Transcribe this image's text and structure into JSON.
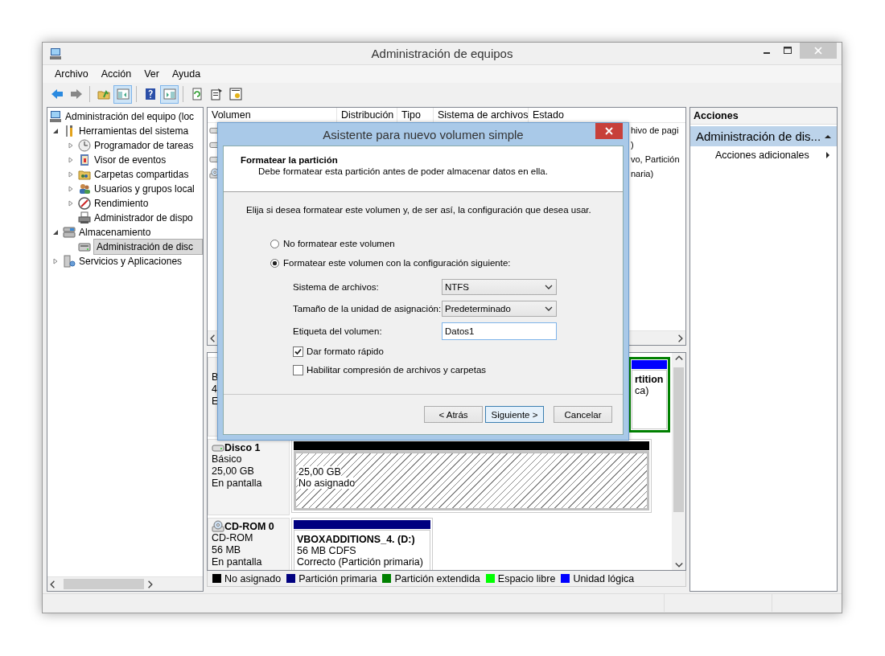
{
  "window": {
    "title": "Administración de equipos"
  },
  "menu": [
    "Archivo",
    "Acción",
    "Ver",
    "Ayuda"
  ],
  "toolbar": [
    [
      {
        "kind": "back",
        "on": false
      },
      {
        "kind": "forward",
        "on": false
      }
    ],
    [
      {
        "kind": "up",
        "on": false
      },
      {
        "kind": "tree-toggle",
        "on": true
      }
    ],
    [
      {
        "kind": "help",
        "on": false
      },
      {
        "kind": "actions-toggle",
        "on": true
      }
    ],
    [
      {
        "kind": "refresh",
        "on": false
      },
      {
        "kind": "properties",
        "on": false
      },
      {
        "kind": "export",
        "on": false
      }
    ]
  ],
  "tree": {
    "label": "Administración del equipo (loc",
    "kind": "computer",
    "selected": false,
    "children": [
      {
        "label": "Herramientas del sistema",
        "kind": "tools",
        "expanded": true,
        "selected": false,
        "children": [
          {
            "label": "Programador de tareas",
            "kind": "clock",
            "expanded": false,
            "selected": false
          },
          {
            "label": "Visor de eventos",
            "kind": "events",
            "expanded": false,
            "selected": false
          },
          {
            "label": "Carpetas compartidas",
            "kind": "shared",
            "expanded": false,
            "selected": false
          },
          {
            "label": "Usuarios y grupos local",
            "kind": "users",
            "expanded": false,
            "selected": false
          },
          {
            "label": "Rendimiento",
            "kind": "performance",
            "expanded": false,
            "selected": false
          },
          {
            "label": "Administrador de dispo",
            "kind": "devices",
            "selected": false
          }
        ]
      },
      {
        "label": "Almacenamiento",
        "kind": "storage",
        "expanded": true,
        "selected": false,
        "children": [
          {
            "label": "Administración de disc",
            "kind": "diskmgmt",
            "selected": true
          }
        ]
      },
      {
        "label": "Servicios y Aplicaciones",
        "kind": "services",
        "expanded": false,
        "selected": false
      }
    ]
  },
  "volume_list": {
    "columns": [
      "Volumen",
      "Distribución",
      "Tipo",
      "Sistema de archivos",
      "Estado"
    ],
    "rows": [
      {
        "kind": "disk",
        "estado": "hivo de pagi"
      },
      {
        "kind": "disk",
        "estado": ")"
      },
      {
        "kind": "disk",
        "estado": "vo, Partición"
      },
      {
        "kind": "cd",
        "estado": "naria)"
      }
    ]
  },
  "disks": [
    {
      "lines": [
        "B",
        "4",
        "E"
      ],
      "partitions": [
        {
          "kind": "logical",
          "name": "rtition",
          "status": "ca)"
        }
      ]
    },
    {
      "kind": "disk",
      "name": "Disco 1",
      "lines": [
        "Básico",
        "25,00 GB",
        "En pantalla"
      ],
      "partitions": [
        {
          "kind": "unallocated",
          "size": "25,00 GB",
          "status": "No asignado"
        }
      ]
    },
    {
      "kind": "cd",
      "name": "CD-ROM 0",
      "lines": [
        "CD-ROM",
        "56 MB",
        "En pantalla"
      ],
      "partitions": [
        {
          "kind": "primary",
          "name": "VBOXADDITIONS_4.  (D:)",
          "size": "56 MB CDFS",
          "status": "Correcto (Partición primaria)"
        }
      ]
    }
  ],
  "legend": [
    {
      "label": "No asignado",
      "color": "#000000"
    },
    {
      "label": "Partición primaria",
      "color": "#000080"
    },
    {
      "label": "Partición extendida",
      "color": "#008000"
    },
    {
      "label": "Espacio libre",
      "color": "#00ff00"
    },
    {
      "label": "Unidad lógica",
      "color": "#0000ff"
    }
  ],
  "actions": {
    "title": "Acciones",
    "section": "Administración de dis...",
    "items": [
      "Acciones adicionales"
    ]
  },
  "dialog": {
    "title": "Asistente para nuevo volumen simple",
    "heading": "Formatear la partición",
    "subheading": "Debe formatear esta partición antes de poder almacenar datos en ella.",
    "instruction": "Elija si desea formatear este volumen y, de ser así, la configuración que desea usar.",
    "options": [
      {
        "label": "No formatear este volumen",
        "selected": false
      },
      {
        "label": "Formatear este volumen con la configuración siguiente:",
        "selected": true
      }
    ],
    "fields": [
      {
        "label": "Sistema de archivos:",
        "kind": "select",
        "value": "NTFS"
      },
      {
        "label": "Tamaño de la unidad de asignación:",
        "kind": "select",
        "value": "Predeterminado"
      },
      {
        "label": "Etiqueta del volumen:",
        "kind": "text",
        "value": "Datos1"
      }
    ],
    "checkboxes": [
      {
        "label": "Dar formato rápido",
        "checked": true
      },
      {
        "label": "Habilitar compresión de archivos y carpetas",
        "checked": false
      }
    ],
    "buttons": [
      {
        "label": "< Atrás",
        "default": false
      },
      {
        "label": "Siguiente >",
        "default": true
      },
      {
        "label": "Cancelar",
        "default": false
      }
    ]
  }
}
